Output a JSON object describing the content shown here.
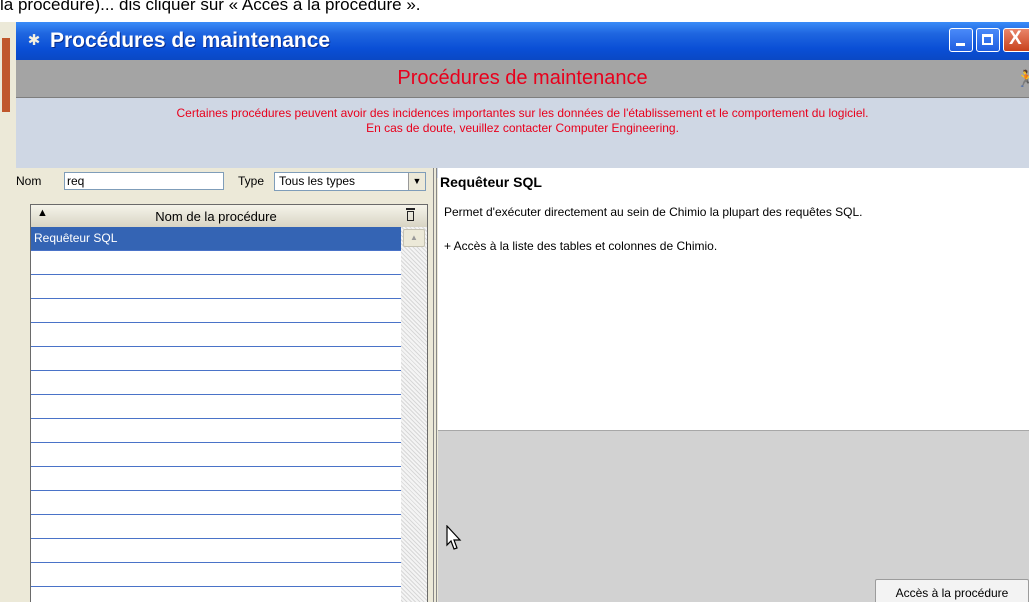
{
  "document": {
    "caption": "la procédure)... dis cliquer sur « Accès à la procédure »."
  },
  "window": {
    "title": "Procédures de maintenance",
    "close_symbol": "X"
  },
  "header": {
    "title": "Procédures de maintenance"
  },
  "warning": {
    "line1": "Certaines procédures peuvent avoir des incidences importantes sur les données de l'établissement et le comportement du logiciel.",
    "line2": "En cas de doute, veuillez contacter Computer Engineering."
  },
  "filter": {
    "nom_label": "Nom",
    "nom_value": "req",
    "type_label": "Type",
    "type_value": "Tous les types"
  },
  "grid": {
    "column_header": "Nom de la procédure",
    "rows": [
      "Requêteur SQL",
      "",
      "",
      "",
      "",
      "",
      "",
      "",
      "",
      "",
      "",
      "",
      "",
      "",
      "",
      ""
    ]
  },
  "detail": {
    "title": "Requêteur SQL",
    "description": "Permet d'exécuter directement au sein de Chimio la plupart des requêtes SQL.",
    "extra": "+ Accès à la liste des tables et colonnes de Chimio."
  },
  "actions": {
    "acces_button": "Accès à la procédure"
  },
  "icons": {
    "app": "gear-icon",
    "header": "running-man-icon",
    "sort": "sort-up-arrow-icon",
    "delete": "trash-icon",
    "cursor": "mouse-pointer-icon"
  },
  "colors": {
    "accent_red": "#e8001c",
    "titlebar_blue": "#0a4fd6",
    "selection_blue": "#3464b4"
  }
}
